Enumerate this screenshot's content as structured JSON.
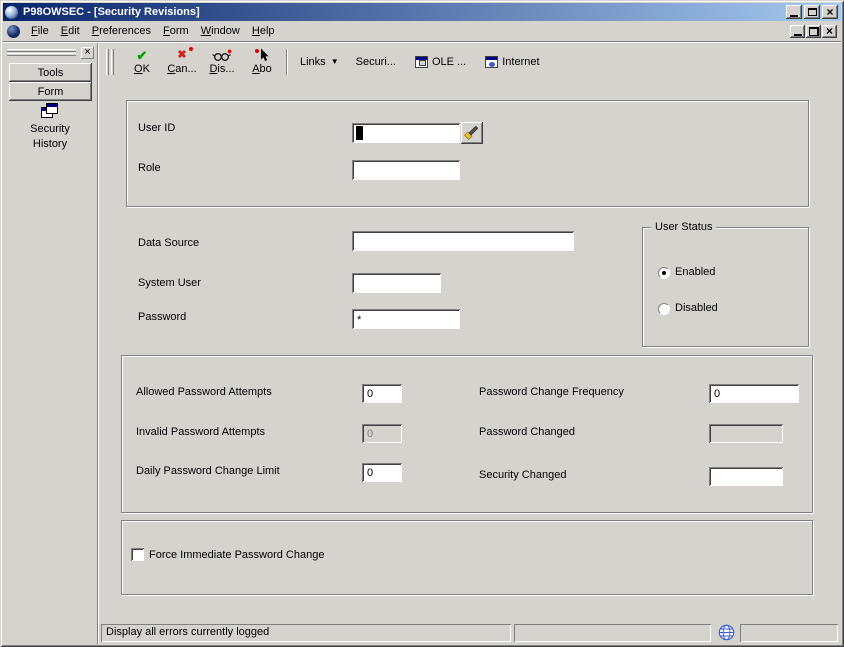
{
  "colors": {
    "window_bg": "#d6d3ce",
    "titlebar_start": "#0a246a",
    "titlebar_end": "#a6caf0",
    "ok_green": "#00a000",
    "cancel_red": "#d02020",
    "alert_red": "#e00000",
    "globe_blue": "#3a5fcd",
    "icon_navy": "#000080"
  },
  "titlebar": {
    "title": "P98OWSEC - [Security Revisions]"
  },
  "menu": {
    "items": [
      "File",
      "Edit",
      "Preferences",
      "Form",
      "Window",
      "Help"
    ]
  },
  "toolbar": {
    "ok_label": "OK",
    "cancel_label": "Can...",
    "display_label": "Dis...",
    "about_label": "Abo",
    "links_label": "Links",
    "security_label": "Securi...",
    "ole_label": "OLE ...",
    "internet_label": "Internet"
  },
  "sidebar": {
    "tools_tab": "Tools",
    "form_tab": "Form",
    "security_history": "Security History"
  },
  "form": {
    "user_id": {
      "label": "User ID",
      "value": ""
    },
    "role": {
      "label": "Role",
      "value": ""
    },
    "data_source": {
      "label": "Data Source",
      "value": ""
    },
    "system_user": {
      "label": "System User",
      "value": ""
    },
    "password": {
      "label": "Password",
      "value": "*"
    },
    "user_status": {
      "title": "User Status",
      "options": [
        {
          "label": "Enabled",
          "selected": true
        },
        {
          "label": "Disabled",
          "selected": false
        }
      ]
    },
    "allowed_attempts": {
      "label": "Allowed Password Attempts",
      "value": "0",
      "disabled": false
    },
    "invalid_attempts": {
      "label": "Invalid Password Attempts",
      "value": "0",
      "disabled": true
    },
    "daily_change_limit": {
      "label": "Daily Password Change Limit",
      "value": "0",
      "disabled": false
    },
    "change_frequency": {
      "label": "Password Change Frequency",
      "value": "0",
      "disabled": false
    },
    "password_changed": {
      "label": "Password Changed",
      "value": "",
      "disabled": true
    },
    "security_changed": {
      "label": "Security Changed",
      "value": "",
      "disabled": false
    },
    "force_change": {
      "label": "Force Immediate Password Change",
      "checked": false
    }
  },
  "statusbar": {
    "message": "Display all errors currently logged"
  },
  "icons": {
    "close": "×",
    "ok_check": "✔",
    "cancel_x": "✖",
    "links_dropdown": "▼"
  }
}
